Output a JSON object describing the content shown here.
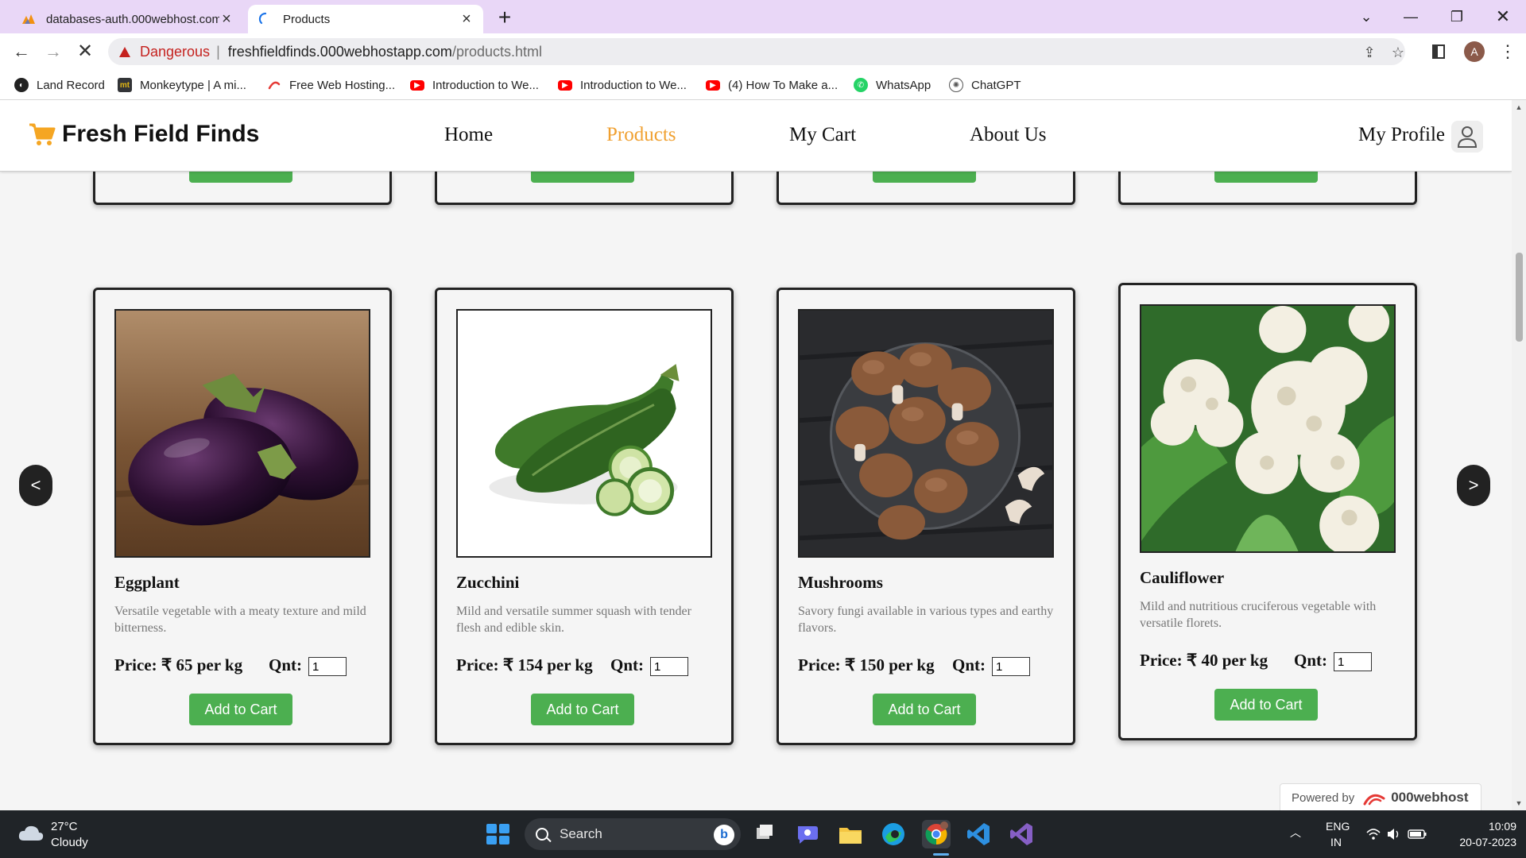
{
  "browser": {
    "tabs": [
      {
        "title": "databases-auth.000webhost.com",
        "active": false
      },
      {
        "title": "Products",
        "active": true
      }
    ],
    "security_label": "Dangerous",
    "url_host": "freshfieldfinds.000webhostapp.com",
    "url_path": "/products.html",
    "profile_initial": "A",
    "bookmarks": [
      {
        "label": "Land Record",
        "icon": "globe-icon"
      },
      {
        "label": "Monkeytype | A mi...",
        "icon": "monkeytype-icon"
      },
      {
        "label": "Free Web Hosting...",
        "icon": "000webhost-icon"
      },
      {
        "label": "Introduction to We...",
        "icon": "youtube-icon"
      },
      {
        "label": "Introduction to We...",
        "icon": "youtube-icon"
      },
      {
        "label": "(4) How To Make a...",
        "icon": "youtube-icon"
      },
      {
        "label": "WhatsApp",
        "icon": "whatsapp-icon"
      },
      {
        "label": "ChatGPT",
        "icon": "chatgpt-icon"
      }
    ]
  },
  "site": {
    "brand": "Fresh Field Finds",
    "nav": [
      {
        "label": "Home",
        "active": false
      },
      {
        "label": "Products",
        "active": true
      },
      {
        "label": "My Cart",
        "active": false
      },
      {
        "label": "About Us",
        "active": false
      }
    ],
    "profile_label": "My Profile",
    "accent_color": "#f0a030",
    "button_color": "#4caf50"
  },
  "products": [
    {
      "name": "Eggplant",
      "description": "Versatile vegetable with a meaty texture and mild bitterness.",
      "price": "Price: ₹ 65 per kg",
      "qnt_label": "Qnt:",
      "qnt_value": "1",
      "button": "Add to Cart"
    },
    {
      "name": "Zucchini",
      "description": "Mild and versatile summer squash with tender flesh and edible skin.",
      "price": "Price: ₹ 154 per kg",
      "qnt_label": "Qnt:",
      "qnt_value": "1",
      "button": "Add to Cart"
    },
    {
      "name": "Mushrooms",
      "description": "Savory fungi available in various types and earthy flavors.",
      "price": "Price: ₹ 150 per kg",
      "qnt_label": "Qnt:",
      "qnt_value": "1",
      "button": "Add to Cart"
    },
    {
      "name": "Cauliflower",
      "description": "Mild and nutritious cruciferous vegetable with versatile florets.",
      "price": "Price: ₹ 40 per kg",
      "qnt_label": "Qnt:",
      "qnt_value": "1",
      "button": "Add to Cart"
    }
  ],
  "carousel": {
    "prev": "<",
    "next": ">"
  },
  "powered_by": {
    "label": "Powered by",
    "brand": "000webhost"
  },
  "taskbar": {
    "weather_temp": "27°C",
    "weather_condition": "Cloudy",
    "search_placeholder": "Search",
    "lang_line1": "ENG",
    "lang_line2": "IN",
    "time": "10:09",
    "date": "20-07-2023"
  }
}
